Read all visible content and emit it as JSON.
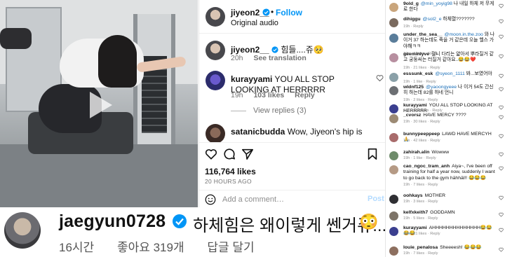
{
  "colors": {
    "link": "#0095f6",
    "verified": "#0095f6",
    "muted": "#737373",
    "mention": "#1a6fb8"
  },
  "video": {
    "play_icon": "play-icon"
  },
  "overlay": {
    "username": "jaegyun0728",
    "text": "하체힘은 왜이렇게 쎈거쥬...?",
    "emoji": "😳",
    "time": "16시간",
    "likes": "좋아요 319개",
    "reply": "답글 달기"
  },
  "post": {
    "username": "jiyeon2__",
    "follow_label": "Follow",
    "audio": "Original audio",
    "caption": {
      "username": "jiyeon2__",
      "text": "힘들....쥬🥺",
      "time": "20h",
      "translate": "See translation"
    },
    "comment1": {
      "username": "kurayyami",
      "text": "YOU ALL STOP LOOKING AT HERRRRR",
      "time": "19h",
      "likes": "103 likes",
      "reply": "Reply",
      "view_replies": "View replies (3)"
    },
    "comment2": {
      "username": "satanicbudda",
      "text": "Wow, Jiyeon's hip is"
    },
    "likes": "116,764 likes",
    "time_ago": "20 HOURS AGO",
    "comment_placeholder": "Add a comment…",
    "post_label": "Post"
  },
  "side_comments": [
    {
      "username": "9old_g",
      "mention": "@min_yoyig98",
      "text": "나 내일 하체 저 무게로 한다",
      "meta": "",
      "color": "#c9a57c"
    },
    {
      "username": "dihiggu",
      "mention": "@sol2_e",
      "text": "하체렬???????",
      "meta": "19h · Reply",
      "color": "#7a6a5e"
    },
    {
      "username": "under_the_sea__",
      "mention": "@moon.in.the.zoo",
      "text": "와 나 이거 37 하는데도 죽을 거 같은데 오늘 헬스 가야해ㅋㅋ",
      "meta": "19h · 3 likes · Reply",
      "color": "#5a7d9a"
    },
    {
      "username": "geeminlyve",
      "mention": "",
      "text": "헐니 다리는 얇아서 뿌라질거 같고 궁둥씨는 터질거 같아요..😂😂❤️",
      "meta": "19h · 21 likes · Reply",
      "color": "#b78fa0"
    },
    {
      "username": "esssunk_esk",
      "mention": "@syeon_1111",
      "text": "봐...보였어야",
      "meta": "19h · 1 like · Reply",
      "color": "#8aa0a8"
    },
    {
      "username": "wldnf125",
      "mention": "@yaoongyeee",
      "text": "나 이거 54도 간신히 하는데 82를 하네 언니",
      "meta": "19h · 2 likes · Reply",
      "color": "#6c6f73"
    },
    {
      "username": "kurayyami",
      "mention": "",
      "text": "YOU ALL STOP LOOKING AT HERRRRR",
      "meta": "19h · 103 likes · Reply",
      "color": "#3b3f8f"
    },
    {
      "username": "_cvorsz",
      "mention": "",
      "text": "HAVE MERCY ????",
      "meta": "19h · 30 likes · Reply",
      "color": "#9c8a74"
    },
    {
      "username": "bunnypeeppeep",
      "mention": "",
      "text": "LAWD HAVE MERCYH 🙏",
      "meta": "19h · 42 likes · Reply",
      "color": "#a86b6b"
    },
    {
      "username": "zahirah.alin",
      "mention": "",
      "text": "Wowww",
      "meta": "19h · 1 like · Reply",
      "color": "#6e8b6a"
    },
    {
      "username": "cao_ngoc_tram_anh",
      "mention": "",
      "text": "Aiya~, I've been off training for half a year now, suddenly I want to go back to the gym hāhhāl!! 😂😂😂",
      "meta": "19h · 7 likes · Reply",
      "color": "#b59a85"
    },
    {
      "username": "oohkays",
      "mention": "",
      "text": "MOTHER",
      "meta": "19h · 3 likes · Reply",
      "color": "#2f2f33"
    },
    {
      "username": "kelfxkeith7",
      "mention": "",
      "text": "GODDAMN",
      "meta": "19h · 5 likes · Reply",
      "color": "#7d7468"
    },
    {
      "username": "kurayyami",
      "mention": "",
      "text": "AHHHHHHHHHHHHHH😂😂😂😂",
      "meta": "19h · 21 likes · Reply",
      "color": "#3b3f8f"
    },
    {
      "username": "louie_penalosa",
      "mention": "",
      "text": "Sheeeesh! 😂😂😂",
      "meta": "19h · 7 likes · Reply",
      "color": "#8d6f5f"
    }
  ]
}
